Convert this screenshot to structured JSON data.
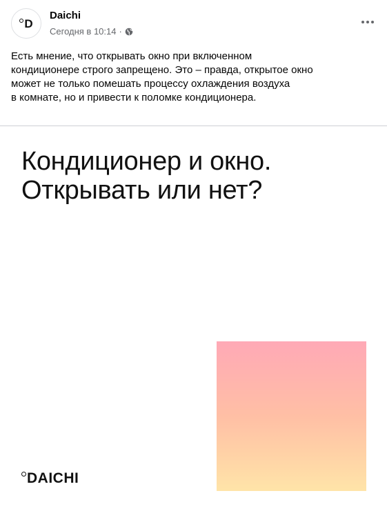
{
  "post": {
    "author": "Daichi",
    "avatar_text": "D",
    "timestamp": "Сегодня в 10:14",
    "separator": "·",
    "privacy_icon": "globe-icon",
    "more_icon": "more-icon",
    "body_lines": [
      "Есть мнение, что открывать окно при включенном",
      "кондиционере строго запрещено. Это – правда, открытое окно",
      "может не только помешать процессу охлаждения воздуха",
      "в комнате, но и привести к поломке кондиционера."
    ]
  },
  "image": {
    "headline_lines": [
      "Кондиционер и окно.",
      "Открывать или нет?"
    ],
    "brand": "DAICHI",
    "gradient_colors": [
      "#ffa9b6",
      "#ffbfa5",
      "#ffe4a8"
    ]
  }
}
